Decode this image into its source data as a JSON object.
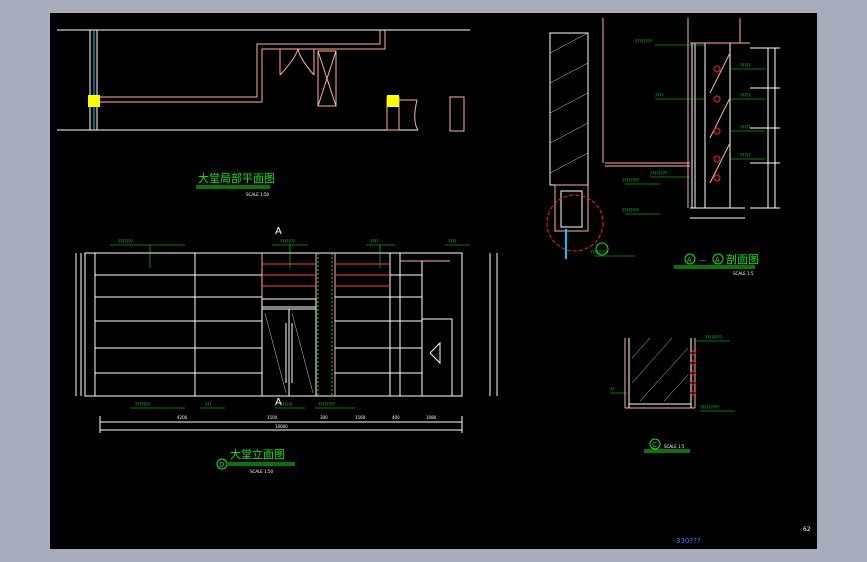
{
  "drawing": {
    "plan_title": "大堂局部平面图",
    "plan_scale": "SCALE 1:50",
    "elevation_title": "大堂立面图",
    "elevation_scale": "SCALE 1:50",
    "elevation_marker": "D",
    "section_title": "剖面图",
    "section_marker_a1": "A",
    "section_marker_a2": "A",
    "section_dash": "—",
    "section_scale": "SCALE 1:5",
    "detail_marker": "C",
    "detail_scale": "SCALE 1:5",
    "footer_code": "330???",
    "page_number": "62"
  },
  "colors": {
    "background": "#000000",
    "frame": "#a7adbd",
    "wall": "#ffb0a0",
    "line": "#ffffff",
    "annotation": "#19e619",
    "highlight": "#ffff00",
    "accent": "#ff2020",
    "glass": "#00c8ff"
  }
}
